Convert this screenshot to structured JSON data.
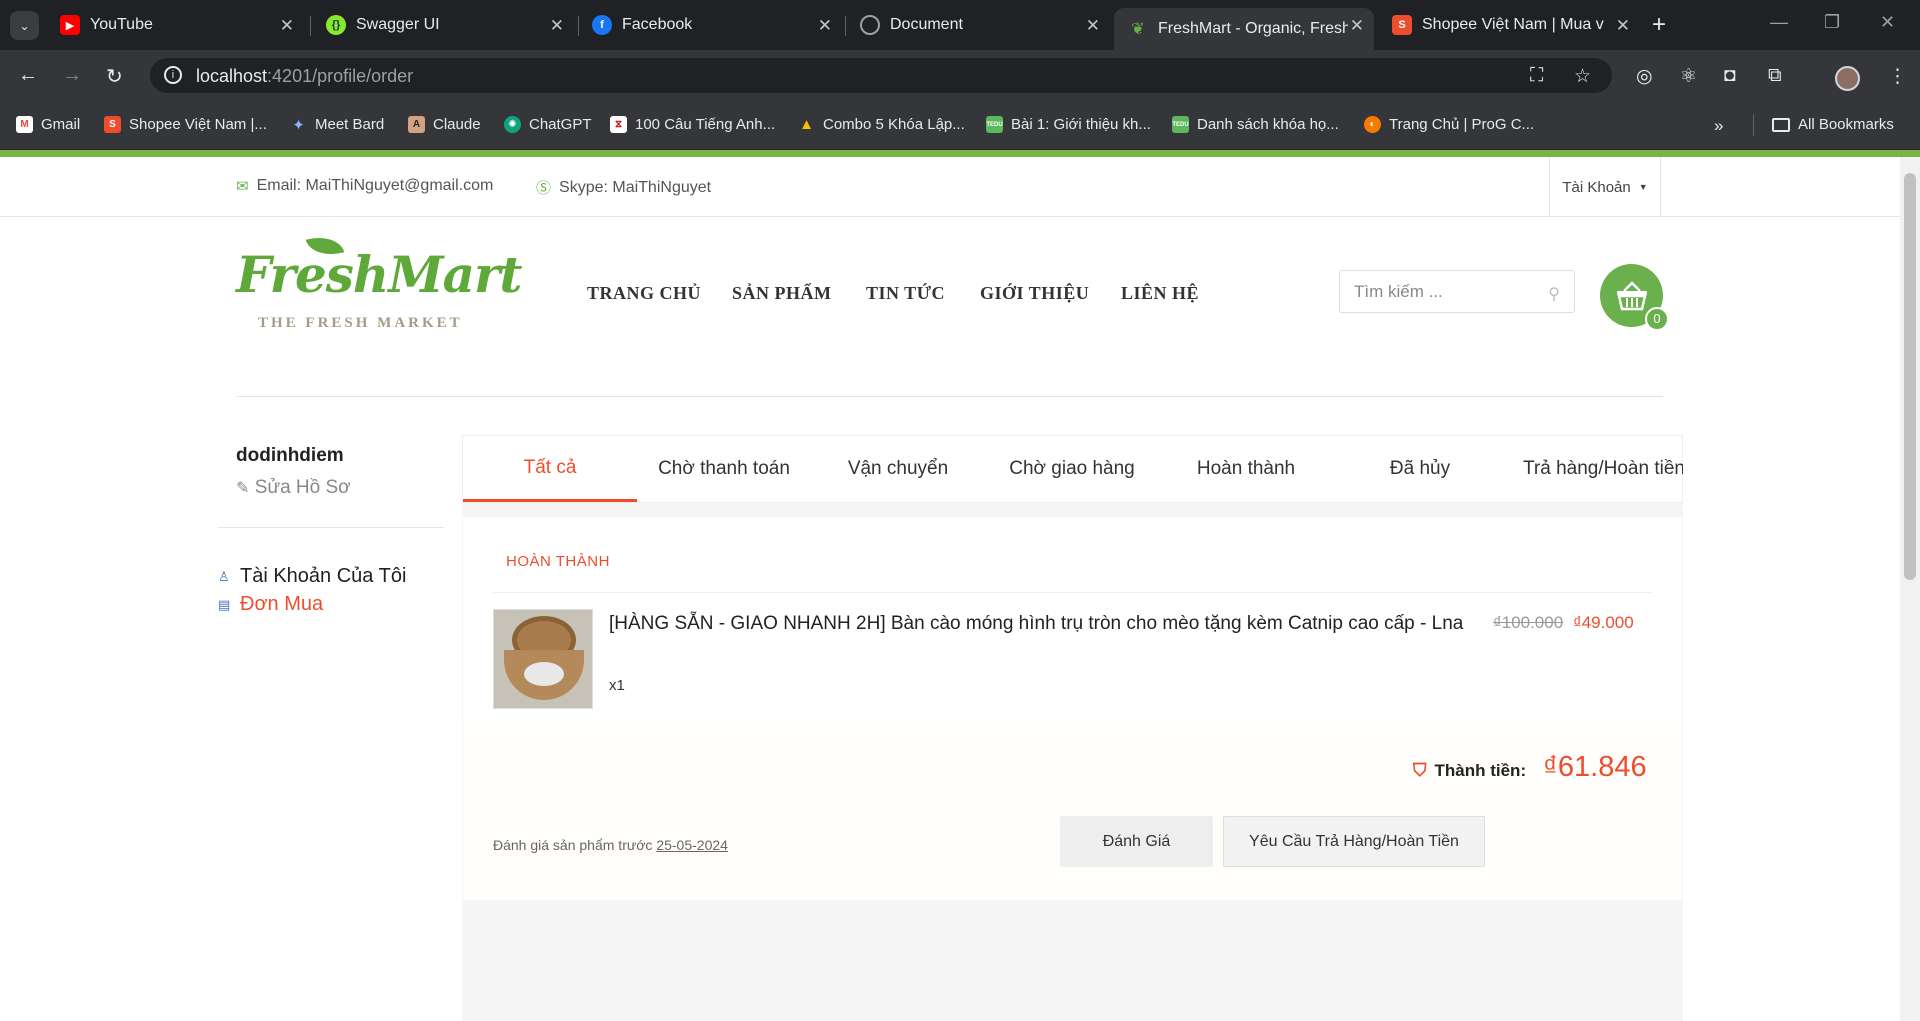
{
  "browser": {
    "tabs": [
      {
        "title": "YouTube",
        "icon": "youtube-icon",
        "color": "#ff0000"
      },
      {
        "title": "Swagger UI",
        "icon": "swagger-icon",
        "color": "#85ea2d"
      },
      {
        "title": "Facebook",
        "icon": "facebook-icon",
        "color": "#1877f2"
      },
      {
        "title": "Document",
        "icon": "globe-icon",
        "color": "#9aa0a6"
      },
      {
        "title": "FreshMart - Organic, Fresh",
        "icon": "leaf-icon",
        "color": "#6ab04c"
      },
      {
        "title": "Shopee Việt Nam | Mua v",
        "icon": "shopee-icon",
        "color": "#ee4d2d"
      }
    ],
    "url_host": "localhost",
    "url_path": ":4201/profile/order",
    "bookmarks": [
      "Gmail",
      "Shopee Việt Nam |...",
      "Meet Bard",
      "Claude",
      "ChatGPT",
      "100 Câu Tiếng Anh...",
      "Combo 5 Khóa Lập...",
      "Bài 1: Giới thiệu kh...",
      "Danh sách khóa họ...",
      "Trang Chủ | ProG C..."
    ],
    "all_bookmarks": "All Bookmarks"
  },
  "site": {
    "email": "Email: MaiThiNguyet@gmail.com",
    "skype": "Skype: MaiThiNguyet",
    "account": "Tài Khoản",
    "logo_text": "FreshMart",
    "logo_tagline": "THE FRESH MARKET",
    "nav": [
      "TRANG CHỦ",
      "SẢN PHẨM",
      "TIN TỨC",
      "GIỚI THIỆU",
      "LIÊN HỆ"
    ],
    "search_placeholder": "Tìm kiếm ...",
    "cart_count": "0",
    "accent": "#6ab04c"
  },
  "sidebar": {
    "username": "dodinhdiem",
    "edit_profile": "Sửa Hồ Sơ",
    "my_account": "Tài Khoản Của Tôi",
    "orders": "Đơn Mua"
  },
  "orders": {
    "tabs": [
      "Tất cả",
      "Chờ thanh toán",
      "Vận chuyển",
      "Chờ giao hàng",
      "Hoàn thành",
      "Đã hủy",
      "Trả hàng/Hoàn tiền"
    ],
    "active_tab": "Tất cả",
    "items": [
      {
        "status": "HOÀN THÀNH",
        "product_name": "[HÀNG SẴN - GIAO NHANH 2H] Bàn cào móng hình trụ tròn cho mèo tặng kèm Catnip cao cấp - Lna",
        "quantity": "x1",
        "original_price": "₫100.000",
        "price": "₫49.000",
        "total_label": "Thành tiền:",
        "total": "₫61.846",
        "review_note": "Đánh giá sản phẩm trước",
        "review_deadline": "25-05-2024",
        "rate_button": "Đánh Giá",
        "refund_button": "Yêu Cầu Trả Hàng/Hoàn Tiền"
      }
    ],
    "accent": "#ee4d2d"
  }
}
